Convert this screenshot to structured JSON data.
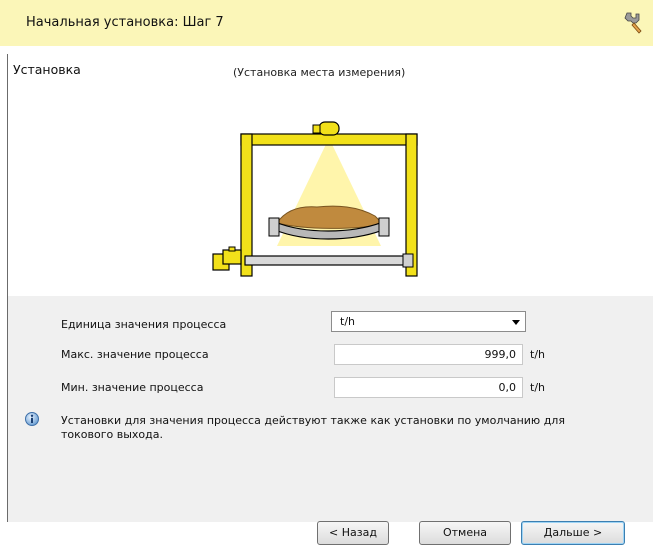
{
  "window": {
    "title": "Начальная установка: Шаг 7",
    "icon": "wrench-icon"
  },
  "section": {
    "label": "Установка",
    "subtitle": "(Установка места измерения)"
  },
  "form": {
    "unit_label": "Единица значения процесса",
    "unit_value": "t/h",
    "max_label": "Макс. значение процесса",
    "max_value": "999,0",
    "max_unit": "t/h",
    "min_label": "Мин. значение процесса",
    "min_value": "0,0",
    "min_unit": "t/h"
  },
  "info": {
    "icon": "info-icon",
    "text": "Установки для значения процесса действуют также как установки по умолчанию для токового выхода."
  },
  "buttons": {
    "back": "< Назад",
    "cancel": "Отмена",
    "next": "Дальше >"
  },
  "colors": {
    "title_bar": "#fbf6b8",
    "frame_yellow": "#f2e11a",
    "beam_yellow": "#fff4a6",
    "material": "#c08a3e",
    "form_bg": "#f0f0f0"
  }
}
